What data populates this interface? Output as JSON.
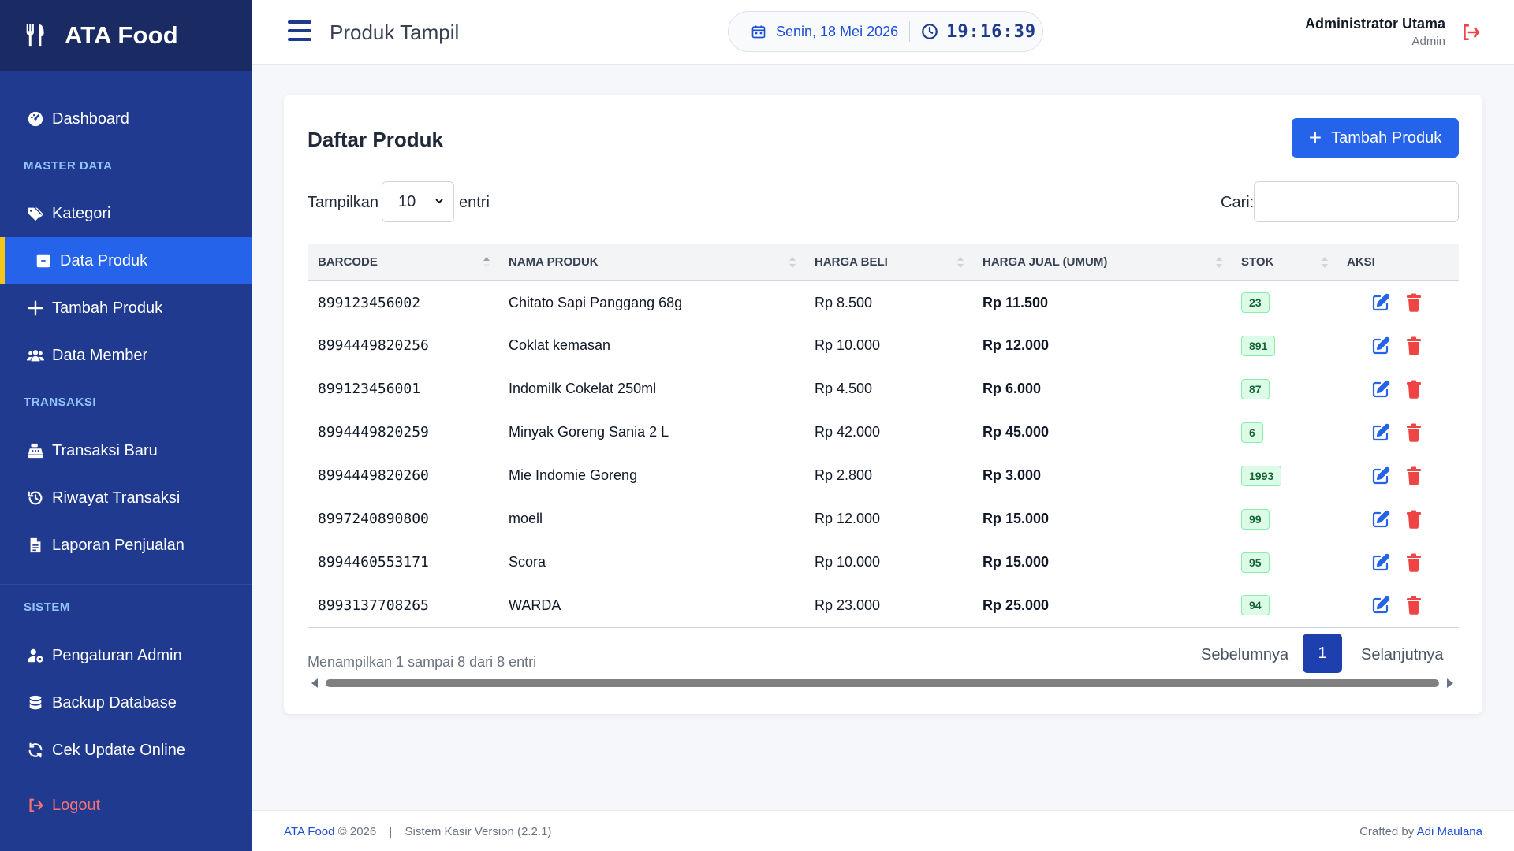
{
  "app": {
    "name": "ATA Food"
  },
  "sidebar": {
    "items": [
      {
        "label": "Dashboard",
        "icon": "dashboard-icon"
      },
      {
        "label": "Kategori",
        "icon": "tags-icon"
      },
      {
        "label": "Data Produk",
        "icon": "box-icon",
        "active": true
      },
      {
        "label": "Tambah Produk",
        "icon": "plus-icon"
      },
      {
        "label": "Data Member",
        "icon": "users-icon"
      },
      {
        "label": "Transaksi Baru",
        "icon": "cash-register-icon"
      },
      {
        "label": "Riwayat Transaksi",
        "icon": "history-icon"
      },
      {
        "label": "Laporan Penjualan",
        "icon": "file-report-icon"
      },
      {
        "label": "Pengaturan Admin",
        "icon": "user-gear-icon"
      },
      {
        "label": "Backup Database",
        "icon": "database-icon"
      },
      {
        "label": "Cek Update Online",
        "icon": "sync-icon"
      }
    ],
    "sections": {
      "master": "MASTER DATA",
      "transaksi": "TRANSAKSI",
      "sistem": "SISTEM"
    },
    "logout": "Logout"
  },
  "topbar": {
    "title": "Produk Tampil",
    "date": "Senin, 18 Mei 2026",
    "time": "19:16:39",
    "user_name": "Administrator Utama",
    "user_role": "Admin"
  },
  "card": {
    "title": "Daftar Produk",
    "add_button": "Tambah Produk",
    "show_label": "Tampilkan",
    "show_value": "10",
    "entries_label": "entri",
    "search_label": "Cari:",
    "search_value": ""
  },
  "table": {
    "headers": [
      "BARCODE",
      "NAMA PRODUK",
      "HARGA BELI",
      "HARGA JUAL (UMUM)",
      "STOK",
      "AKSI"
    ],
    "rows": [
      {
        "barcode": "899123456002",
        "name": "Chitato Sapi Panggang 68g",
        "beli": "Rp 8.500",
        "jual": "Rp 11.500",
        "stok": "23"
      },
      {
        "barcode": "8994449820256",
        "name": "Coklat kemasan",
        "beli": "Rp 10.000",
        "jual": "Rp 12.000",
        "stok": "891"
      },
      {
        "barcode": "899123456001",
        "name": "Indomilk Cokelat 250ml",
        "beli": "Rp 4.500",
        "jual": "Rp 6.000",
        "stok": "87"
      },
      {
        "barcode": "8994449820259",
        "name": "Minyak Goreng Sania 2 L",
        "beli": "Rp 42.000",
        "jual": "Rp 45.000",
        "stok": "6"
      },
      {
        "barcode": "8994449820260",
        "name": "Mie Indomie Goreng",
        "beli": "Rp 2.800",
        "jual": "Rp 3.000",
        "stok": "1993"
      },
      {
        "barcode": "8997240890800",
        "name": "moell",
        "beli": "Rp 12.000",
        "jual": "Rp 15.000",
        "stok": "99"
      },
      {
        "barcode": "8994460553171",
        "name": "Scora",
        "beli": "Rp 10.000",
        "jual": "Rp 15.000",
        "stok": "95"
      },
      {
        "barcode": "8993137708265",
        "name": "WARDA",
        "beli": "Rp 23.000",
        "jual": "Rp 25.000",
        "stok": "94"
      }
    ]
  },
  "pagination": {
    "info": "Menampilkan 1 sampai 8 dari 8 entri",
    "prev": "Sebelumnya",
    "current": "1",
    "next": "Selanjutnya"
  },
  "footer": {
    "brand": "ATA Food",
    "copyright": "© 2026",
    "separator": "|",
    "version": "Sistem Kasir Version (2.2.1)",
    "crafted_by": "Crafted by",
    "author": "Adi Maulana"
  },
  "colors": {
    "sidebar": "#203a8f",
    "brand_bar": "#1a2b63",
    "accent": "#2563eb",
    "active_marker": "#f5c518",
    "danger": "#ef4444"
  }
}
